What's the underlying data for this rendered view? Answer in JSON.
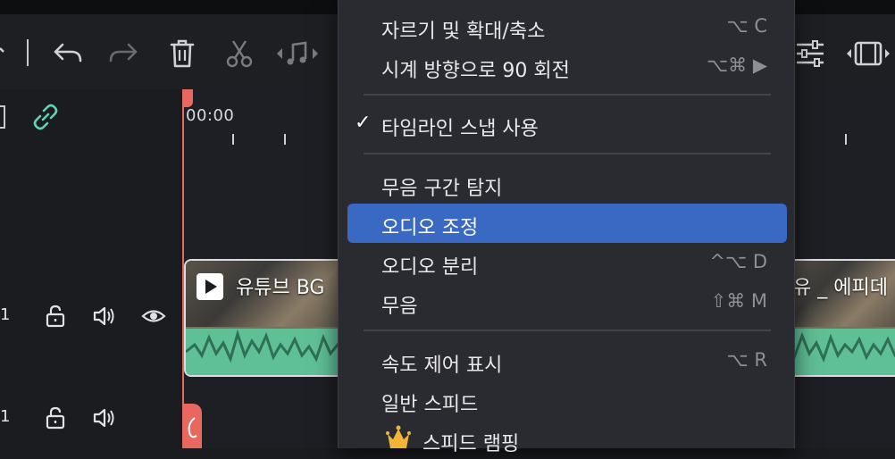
{
  "timeline": {
    "timecode": "00:00"
  },
  "tracks": [
    {
      "number": "1"
    },
    {
      "number": "1"
    }
  ],
  "clips": [
    {
      "title": "유튜브 BG"
    },
    {
      "title": "유 _ 에피데"
    }
  ],
  "menu": {
    "items": [
      {
        "label": "자르기 및 확대/축소",
        "shortcut": "⌥ C"
      },
      {
        "label": "시계 방향으로 90 회전",
        "shortcut": "⌥⌘ ▶"
      },
      {
        "label": "타임라인 스냅 사용",
        "checked": "✓"
      },
      {
        "label": "무음 구간 탐지"
      },
      {
        "label": "오디오 조정"
      },
      {
        "label": "오디오 분리",
        "shortcut": "^⌥ D"
      },
      {
        "label": "무음",
        "shortcut": "⇧⌘ M"
      },
      {
        "label": "속도 제어 표시",
        "shortcut": "⌥ R"
      },
      {
        "label": "일반 스피드"
      },
      {
        "label": "스피드 램핑"
      }
    ]
  },
  "colors": {
    "accent": "#3a69c4",
    "playhead": "#e8685f",
    "waveform": "#5fbf95",
    "link": "#5fd3b5"
  }
}
